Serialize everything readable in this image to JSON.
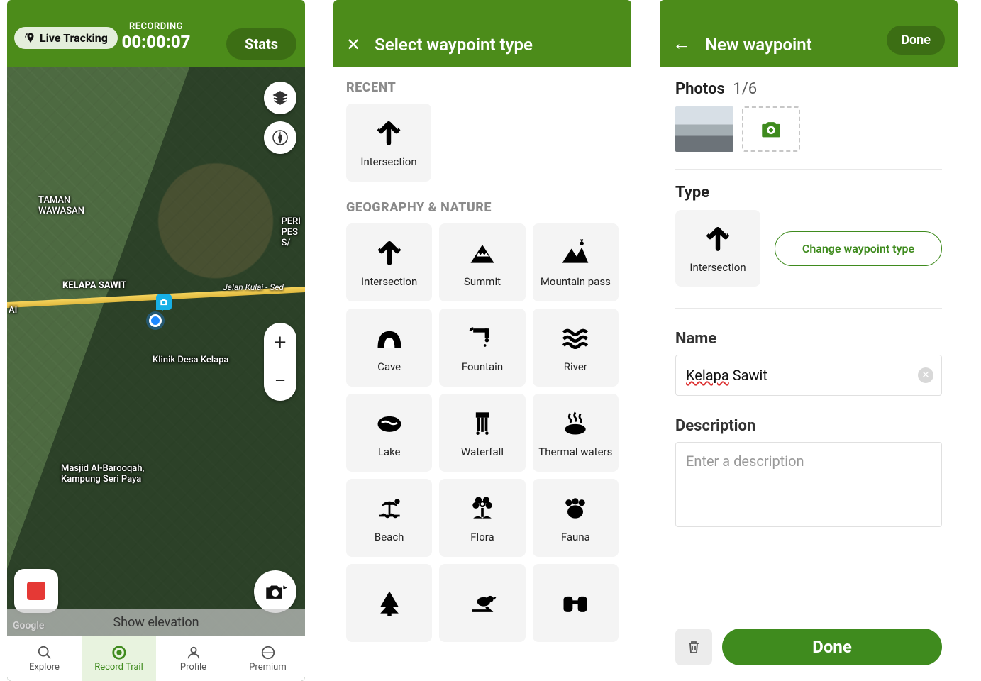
{
  "colors": {
    "brand": "#4c8c1a",
    "brandDark": "#3c6e14",
    "accent": "#3f8b1e"
  },
  "screen1": {
    "liveTracking": "Live Tracking",
    "recordingLabel": "RECORDING",
    "recordingTime": "00:00:07",
    "statsBtn": "Stats",
    "showElevation": "Show elevation",
    "attribution": "Google",
    "mapLabels": {
      "taman": "TAMAN\nWAWASAN",
      "peri": "PERI\nPES\nS/",
      "kelapa": "KELAPA SAWIT",
      "road": "Jalan Kulai - Sed",
      "ai": "AI",
      "clinic": "Klinik Desa Kelapa",
      "mosque": "Masjid Al-Barooqah,\nKampung Seri Paya"
    },
    "tabs": [
      {
        "id": "explore",
        "label": "Explore"
      },
      {
        "id": "record",
        "label": "Record Trail"
      },
      {
        "id": "profile",
        "label": "Profile"
      },
      {
        "id": "premium",
        "label": "Premium"
      }
    ],
    "activeTab": "record"
  },
  "screen2": {
    "title": "Select waypoint type",
    "sections": {
      "recent": {
        "title": "RECENT",
        "items": [
          {
            "id": "intersection",
            "label": "Intersection"
          }
        ]
      },
      "geo": {
        "title": "GEOGRAPHY & NATURE",
        "items": [
          {
            "id": "intersection",
            "label": "Intersection"
          },
          {
            "id": "summit",
            "label": "Summit"
          },
          {
            "id": "mountain-pass",
            "label": "Mountain pass"
          },
          {
            "id": "cave",
            "label": "Cave"
          },
          {
            "id": "fountain",
            "label": "Fountain"
          },
          {
            "id": "river",
            "label": "River"
          },
          {
            "id": "lake",
            "label": "Lake"
          },
          {
            "id": "waterfall",
            "label": "Waterfall"
          },
          {
            "id": "thermal",
            "label": "Thermal waters"
          },
          {
            "id": "beach",
            "label": "Beach"
          },
          {
            "id": "flora",
            "label": "Flora"
          },
          {
            "id": "fauna",
            "label": "Fauna"
          },
          {
            "id": "tree",
            "label": ""
          },
          {
            "id": "bird",
            "label": ""
          },
          {
            "id": "binoculars",
            "label": ""
          }
        ]
      }
    }
  },
  "screen3": {
    "title": "New waypoint",
    "doneSmall": "Done",
    "photosLabel": "Photos",
    "photosCount": "1/6",
    "typeLabel": "Type",
    "selectedType": "Intersection",
    "changeTypeBtn": "Change waypoint type",
    "nameLabel": "Name",
    "nameValue": "Kelapa Sawit",
    "nameSpell": "Kelapa",
    "descLabel": "Description",
    "descPlaceholder": "Enter a description",
    "doneBig": "Done"
  }
}
